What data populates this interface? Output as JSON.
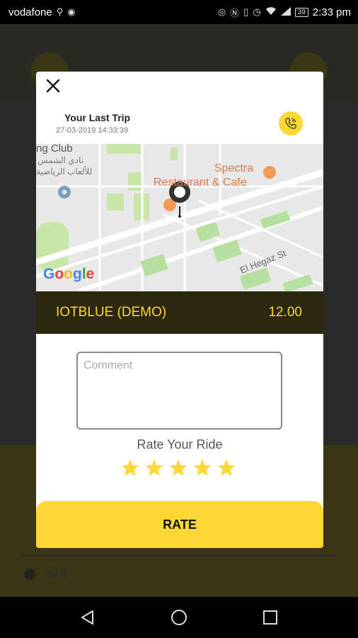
{
  "status_bar": {
    "carrier": "vodafone",
    "battery": "39",
    "time": "2:33 pm"
  },
  "background": {
    "na_label": "N/A"
  },
  "modal": {
    "trip_title": "Your Last Trip",
    "trip_date": "27-03-2019 14:33:39",
    "map": {
      "label_club": "ng Club",
      "label_arabic": "نادي الشمس",
      "label_arabic2": "للألعاب الرياضية",
      "label_spectra": "Spectra",
      "label_restaurant": "Restaurant & Cafe",
      "label_street": "El Hegaz St",
      "google": [
        "G",
        "o",
        "o",
        "g",
        "l",
        "e"
      ],
      "google_colors": [
        "#4285F4",
        "#EA4335",
        "#FBBC05",
        "#4285F4",
        "#34A853",
        "#EA4335"
      ]
    },
    "trip_name": "IOTBLUE (DEMO)",
    "trip_price": "12.00",
    "comment_placeholder": "Comment",
    "rate_label": "Rate Your Ride",
    "rating": 5,
    "rate_button": "RATE"
  },
  "colors": {
    "accent": "#fdd835",
    "dark_bar": "#2b2810"
  }
}
